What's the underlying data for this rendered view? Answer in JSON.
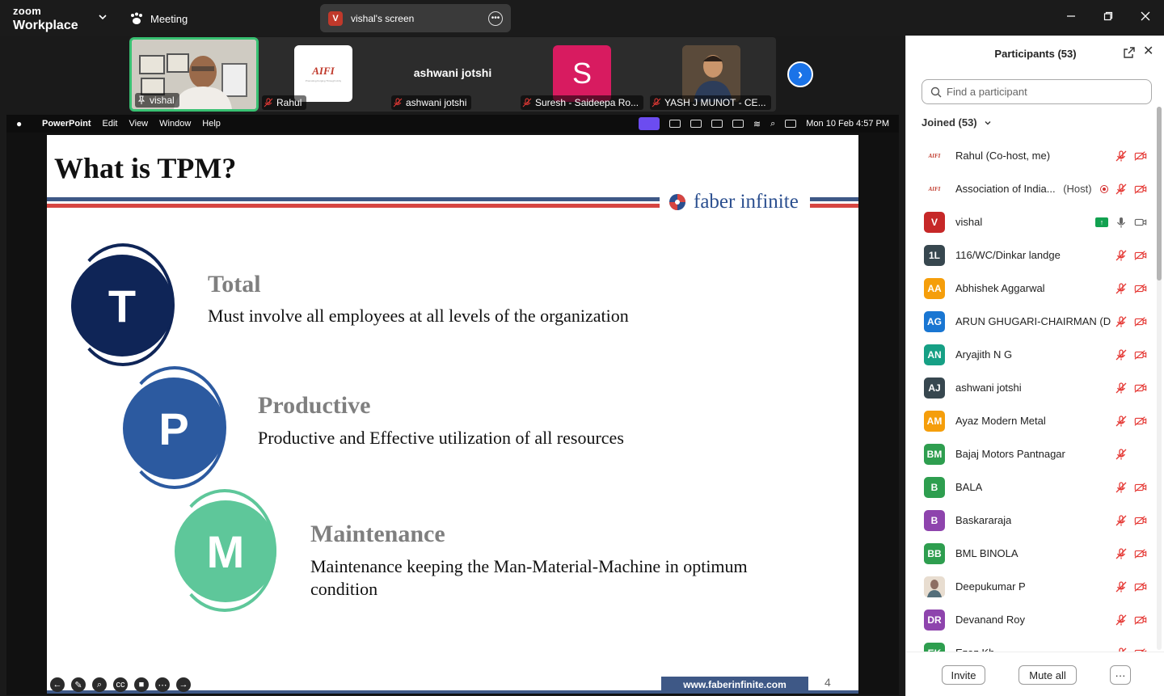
{
  "titlebar": {
    "brand_top": "zoom",
    "brand_bottom": "Workplace",
    "meeting_label": "Meeting",
    "share_badge": "V",
    "share_title": "vishal's screen"
  },
  "video_strip": {
    "tiles": [
      {
        "name": "vishal"
      },
      {
        "name": "Rahul",
        "logo_text": "AIFI",
        "logo_sub": "Promoting Forging Through Unity"
      },
      {
        "name": "ashwani jotshi",
        "display": "ashwani jotshi"
      },
      {
        "name": "Suresh - Saideepa Ro...",
        "avatar_letter": "S"
      },
      {
        "name": "YASH J MUNOT - CE..."
      }
    ]
  },
  "mac_menubar": {
    "app": "PowerPoint",
    "items": [
      "Edit",
      "View",
      "Window",
      "Help"
    ],
    "datetime": "Mon 10 Feb  4:57 PM"
  },
  "slide": {
    "title": "What is TPM?",
    "brand": "faber infinite",
    "items": [
      {
        "letter": "T",
        "heading": "Total",
        "desc": "Must involve all employees at all levels of the organization",
        "color": "#0f2557"
      },
      {
        "letter": "P",
        "heading": "Productive",
        "desc": "Productive and Effective utilization of all resources",
        "color": "#2c5aa0"
      },
      {
        "letter": "M",
        "heading": "Maintenance",
        "desc": "Maintenance keeping the Man-Material-Machine in optimum condition",
        "color": "#5ec79a"
      }
    ],
    "footer_url": "www.faberinfinite.com",
    "page_number": "4"
  },
  "participants_panel": {
    "title": "Participants (53)",
    "search_placeholder": "Find a participant",
    "joined_label": "Joined (53)",
    "participants": [
      {
        "avatar": "AIFI",
        "avatar_type": "logo",
        "name": "Rahul (Co-host, me)",
        "role": "",
        "audio": "muted",
        "video": "off"
      },
      {
        "avatar": "AIFI",
        "avatar_type": "logo",
        "name": "Association of India...",
        "role": "(Host)",
        "recording": true,
        "audio": "muted",
        "video": "off"
      },
      {
        "avatar": "V",
        "color": "#c62828",
        "name": "vishal",
        "role": "",
        "sharing": true,
        "audio": "on",
        "video": "on"
      },
      {
        "avatar": "1L",
        "color": "#37474f",
        "name": "116/WC/Dinkar landge",
        "role": "",
        "audio": "muted",
        "video": "off"
      },
      {
        "avatar": "AA",
        "color": "#f59e0b",
        "name": "Abhishek Aggarwal",
        "role": "",
        "audio": "muted",
        "video": "off"
      },
      {
        "avatar": "AG",
        "color": "#1976d2",
        "name": "ARUN GHUGARI-CHAIRMAN (D...",
        "role": "",
        "audio": "muted",
        "video": "off"
      },
      {
        "avatar": "AN",
        "color": "#16a085",
        "name": "Aryajith N G",
        "role": "",
        "audio": "muted",
        "video": "off"
      },
      {
        "avatar": "AJ",
        "color": "#37474f",
        "name": "ashwani jotshi",
        "role": "",
        "audio": "muted",
        "video": "off"
      },
      {
        "avatar": "AM",
        "color": "#f59e0b",
        "name": "Ayaz Modern Metal",
        "role": "",
        "audio": "muted",
        "video": "off"
      },
      {
        "avatar": "BM",
        "color": "#2e9e4f",
        "name": "Bajaj Motors Pantnagar",
        "role": "",
        "audio": "muted",
        "video": "none"
      },
      {
        "avatar": "B",
        "color": "#2e9e4f",
        "name": "BALA",
        "role": "",
        "audio": "muted",
        "video": "off"
      },
      {
        "avatar": "B",
        "color": "#8e44ad",
        "name": "Baskararaja",
        "role": "",
        "audio": "muted",
        "video": "off"
      },
      {
        "avatar": "BB",
        "color": "#2e9e4f",
        "name": "BML BINOLA",
        "role": "",
        "audio": "muted",
        "video": "off"
      },
      {
        "avatar": "",
        "avatar_type": "photo",
        "color": "#8d6e63",
        "name": "Deepukumar P",
        "role": "",
        "audio": "muted",
        "video": "off"
      },
      {
        "avatar": "DR",
        "color": "#8e44ad",
        "name": "Devanand Roy",
        "role": "",
        "audio": "muted",
        "video": "off"
      },
      {
        "avatar": "EK",
        "color": "#2e9e4f",
        "name": "Ezaz Kh...",
        "role": "",
        "audio": "muted",
        "video": "off"
      }
    ],
    "invite_label": "Invite",
    "mute_all_label": "Mute all",
    "more_label": "···"
  }
}
